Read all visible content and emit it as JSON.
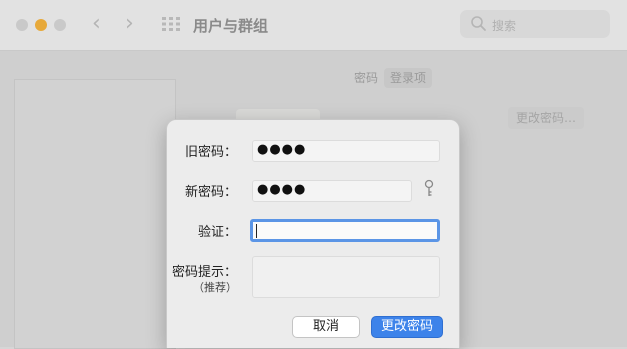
{
  "window": {
    "title": "用户与群组",
    "search_placeholder": "搜索"
  },
  "background": {
    "tabs": [
      "密码",
      "登录项"
    ],
    "change_password_button": "更改密码…"
  },
  "dialog": {
    "old_password_label": "旧密码：",
    "old_password_value": "●●●●",
    "new_password_label": "新密码：",
    "new_password_value": "●●●●",
    "verify_label": "验证：",
    "verify_value": "",
    "hint_label": "密码提示：",
    "hint_sublabel": "（推荐）",
    "hint_value": "",
    "cancel_label": "取消",
    "confirm_label": "更改密码"
  },
  "colors": {
    "accent": "#3d83ea",
    "focus_ring": "#5b95e6",
    "minimize": "#e7a93a"
  }
}
